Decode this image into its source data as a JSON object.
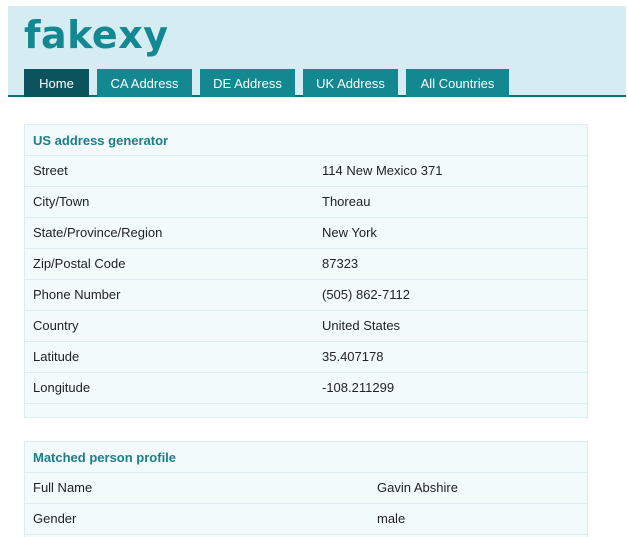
{
  "header": {
    "logo": "fakexy",
    "nav": [
      {
        "label": "Home",
        "active": true
      },
      {
        "label": "CA Address",
        "active": false
      },
      {
        "label": "DE Address",
        "active": false
      },
      {
        "label": "UK Address",
        "active": false
      },
      {
        "label": "All Countries",
        "active": false
      }
    ]
  },
  "us_address": {
    "title": "US address generator",
    "rows": [
      {
        "label": "Street",
        "value": "114 New Mexico 371"
      },
      {
        "label": "City/Town",
        "value": "Thoreau"
      },
      {
        "label": "State/Province/Region",
        "value": "New York"
      },
      {
        "label": "Zip/Postal Code",
        "value": "87323"
      },
      {
        "label": "Phone Number",
        "value": "(505) 862-7112"
      },
      {
        "label": "Country",
        "value": "United States"
      },
      {
        "label": "Latitude",
        "value": "35.407178"
      },
      {
        "label": "Longitude",
        "value": "-108.211299"
      }
    ]
  },
  "person_profile": {
    "title": "Matched person profile",
    "rows": [
      {
        "label": "Full Name",
        "value": "Gavin Abshire"
      },
      {
        "label": "Gender",
        "value": "male"
      }
    ]
  },
  "colors": {
    "brand": "#138891",
    "nav_active": "#0c545d",
    "header_bg": "#d6ecf3",
    "card_bg": "#f2fafb",
    "card_title": "#1a7f88"
  }
}
